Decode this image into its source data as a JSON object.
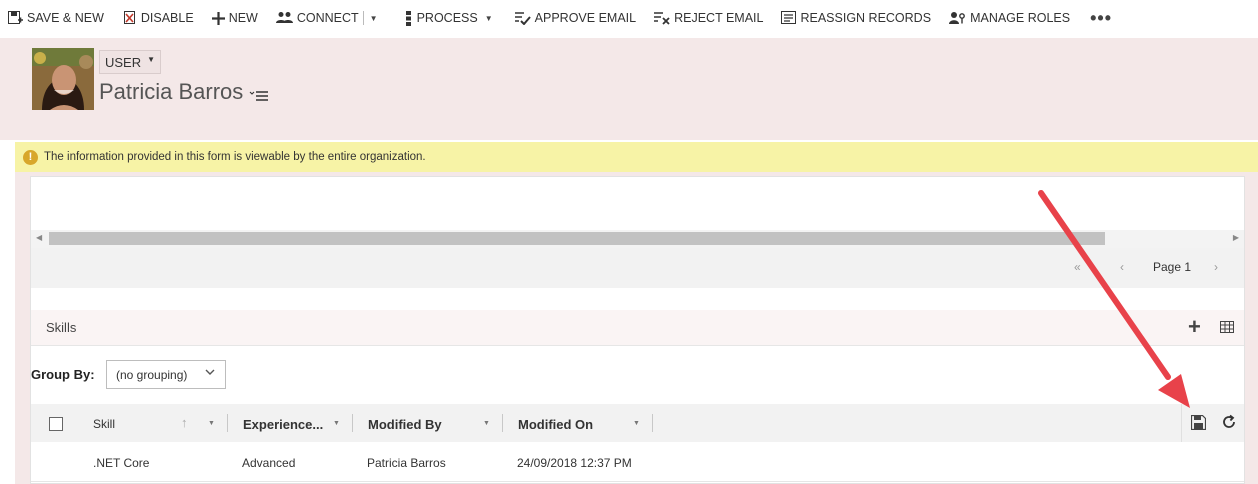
{
  "commandbar": {
    "items": [
      {
        "label": "SAVE & NEW",
        "icon": "save-new-icon"
      },
      {
        "label": "DISABLE",
        "icon": "disable-icon"
      },
      {
        "label": "NEW",
        "icon": "plus-icon"
      },
      {
        "label": "CONNECT",
        "icon": "connect-icon"
      },
      {
        "label": "PROCESS",
        "icon": "process-icon"
      },
      {
        "label": "APPROVE EMAIL",
        "icon": "approve-email-icon"
      },
      {
        "label": "REJECT EMAIL",
        "icon": "reject-email-icon"
      },
      {
        "label": "REASSIGN RECORDS",
        "icon": "reassign-records-icon"
      },
      {
        "label": "MANAGE ROLES",
        "icon": "manage-roles-icon"
      }
    ],
    "more": "•••"
  },
  "header": {
    "entity": "USER",
    "record_name": "Patricia Barros"
  },
  "notification": {
    "text": "The information provided in this form is viewable by the entire organization."
  },
  "pager": {
    "first": "«",
    "prev": "‹",
    "page_label": "Page 1",
    "next": "›"
  },
  "skills": {
    "title": "Skills",
    "group_by_label": "Group By:",
    "group_by_value": "(no grouping)",
    "columns": [
      "Skill",
      "Experience...",
      "Modified By",
      "Modified On"
    ],
    "rows": [
      {
        "skill": ".NET Core",
        "experience": "Advanced",
        "modified_by": "Patricia Barros",
        "modified_on": "24/09/2018 12:37 PM"
      }
    ]
  },
  "colors": {
    "header_bg": "#f4e8e8",
    "notification_bg": "#f7f3a6",
    "arrow": "#e8424a"
  }
}
